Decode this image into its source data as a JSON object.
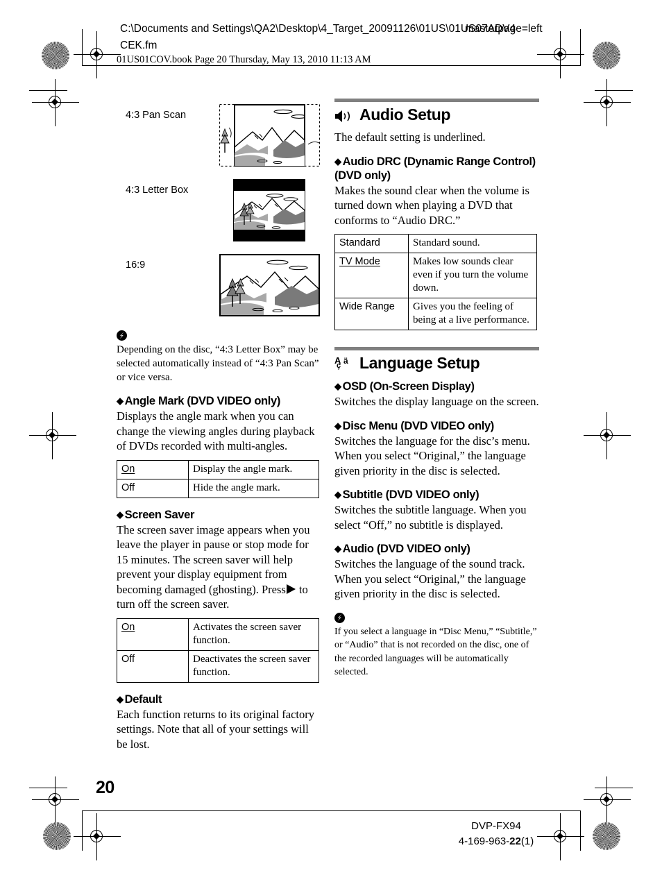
{
  "header": {
    "file_path": "C:\\Documents and Settings\\QA2\\Desktop\\4_Target_20091126\\01US\\01US07ADV4",
    "file_path_line2": "CEK.fm",
    "overlay_text": "masterpage=left",
    "book_line": "01US01COV.book  Page 20  Thursday, May 13, 2010  11:13 AM"
  },
  "left_column": {
    "figures": [
      {
        "label": "4:3 Pan Scan",
        "type": "pan-scan"
      },
      {
        "label": "4:3 Letter Box",
        "type": "letter-box"
      },
      {
        "label": "16:9",
        "type": "wide"
      }
    ],
    "note1": {
      "text": "Depending on the disc, “4:3 Letter Box” may be selected automatically instead of “4:3 Pan Scan” or vice versa."
    },
    "angle_mark": {
      "heading": "Angle Mark (DVD VIDEO only)",
      "body": "Displays the angle mark when you can change the viewing angles during playback of DVDs recorded with multi-angles.",
      "table": [
        {
          "key": "On",
          "underlined": true,
          "value": "Display the angle mark."
        },
        {
          "key": "Off",
          "underlined": false,
          "value": "Hide the angle mark."
        }
      ]
    },
    "screen_saver": {
      "heading": "Screen Saver",
      "body_part1": "The screen saver image appears when you leave the player in pause or stop mode for 15 minutes. The screen saver will help prevent your display equipment from becoming damaged (ghosting). Press",
      "body_part2": "to turn off the screen saver.",
      "table": [
        {
          "key": "On",
          "underlined": true,
          "value": "Activates the screen saver function."
        },
        {
          "key": "Off",
          "underlined": false,
          "value": "Deactivates the screen saver function."
        }
      ]
    },
    "default": {
      "heading": "Default",
      "body": "Each function returns to its original factory settings. Note that all of your settings will be lost."
    }
  },
  "right_column": {
    "audio_setup": {
      "title": "Audio Setup",
      "icon": "speaker-icon",
      "intro": "The default setting is underlined.",
      "audio_drc": {
        "heading_line1": "Audio DRC (Dynamic Range Control)",
        "heading_line2": "(DVD only)",
        "body": "Makes the sound clear when the volume is turned down when playing a DVD that conforms to “Audio DRC.”",
        "table": [
          {
            "key": "Standard",
            "underlined": false,
            "value": "Standard sound."
          },
          {
            "key": "TV Mode",
            "underlined": true,
            "value": "Makes low sounds clear even if you turn the volume down."
          },
          {
            "key": "Wide Range",
            "underlined": false,
            "value": "Gives you the feeling of being at a live performance."
          }
        ]
      }
    },
    "language_setup": {
      "title": "Language Setup",
      "icon": "language-abc-icon",
      "sections": [
        {
          "heading": "OSD (On-Screen Display)",
          "body": "Switches the display language on the screen."
        },
        {
          "heading": "Disc Menu (DVD VIDEO only)",
          "body": "Switches the language for the disc’s menu. When you select “Original,” the language given priority in the disc is selected."
        },
        {
          "heading": "Subtitle (DVD VIDEO only)",
          "body": "Switches the subtitle language. When you select “Off,” no subtitle is displayed."
        },
        {
          "heading": "Audio (DVD VIDEO only)",
          "body": "Switches the language of the sound track. When you select “Original,” the language given priority in the disc is selected."
        }
      ],
      "note": {
        "text": "If you select a language in “Disc Menu,” “Subtitle,” or “Audio” that is not recorded on the disc, one of the recorded languages will be automatically selected."
      }
    }
  },
  "page_number": "20",
  "footer": {
    "model": "DVP-FX94",
    "doc_prefix": "4-169-963-",
    "doc_bold": "22",
    "doc_suffix": "(1)"
  },
  "colors": {
    "section_bar": "#808080",
    "ink": "#000000",
    "sky_fill": "#ffffff",
    "hill_mid": "#a8a8a8",
    "hill_dark": "#7a7a7a"
  }
}
